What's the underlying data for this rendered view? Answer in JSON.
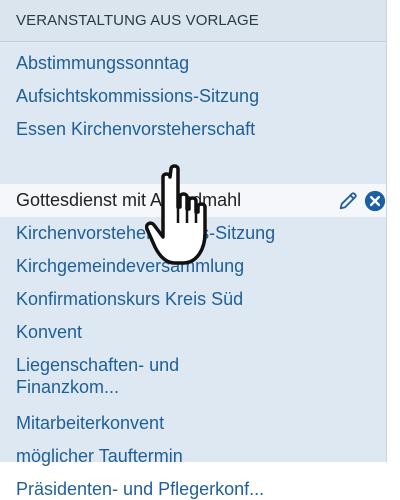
{
  "panel": {
    "header": "VERANSTALTUNG AUS VORLAGE",
    "items": [
      {
        "label": "Abstimmungssonntag"
      },
      {
        "label": "Aufsichtskommissions-Sitzung"
      },
      {
        "label": "Essen Kirchenvorsteherschaft"
      },
      {
        "label": "Gottesdienst mit Abendmahl",
        "highlighted": true
      },
      {
        "label": "Kirchenvorsteherschafts-Sitzung"
      },
      {
        "label": "Kirchgemeindeversammlung"
      },
      {
        "label": "Konfirmationskurs Kreis Süd"
      },
      {
        "label": "Konvent"
      },
      {
        "label": "Liegenschaften- und Finanzkom..."
      },
      {
        "label": "Mitarbeiterkonvent"
      },
      {
        "label": "möglicher Tauftermin"
      },
      {
        "label": "Präsidenten- und Pflegerkonf..."
      }
    ],
    "row_actions": {
      "edit_icon": "pencil-icon",
      "delete_icon": "close-circle-icon"
    }
  },
  "colors": {
    "link": "#1f5f9a",
    "header_bg": "#dbe5ee",
    "panel_bg": "#dde8f2",
    "highlight_bg": "#f5f7fa",
    "delete": "#1c5fa3"
  },
  "cursor": {
    "icon": "hand-pointer-icon"
  }
}
